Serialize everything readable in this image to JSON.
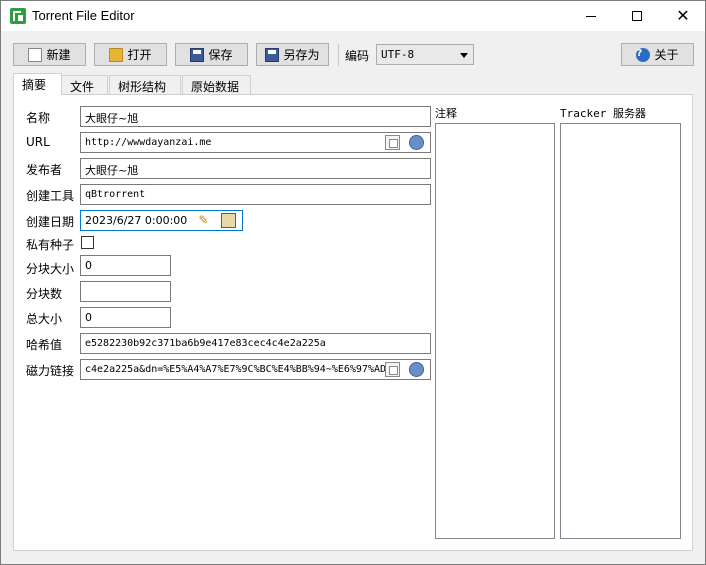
{
  "window": {
    "title": "Torrent File Editor"
  },
  "toolbar": {
    "new_label": "新建",
    "open_label": "打开",
    "save_label": "保存",
    "save_as_label": "另存为",
    "encoding_label": "编码",
    "encoding_value": "UTF-8",
    "about_label": "关于"
  },
  "tabs": [
    {
      "label": "摘要",
      "active": true
    },
    {
      "label": "文件",
      "active": false
    },
    {
      "label": "树形结构",
      "active": false
    },
    {
      "label": "原始数据",
      "active": false
    }
  ],
  "summary": {
    "name_label": "名称",
    "name_value": "大眼仔~旭",
    "url_label": "URL",
    "url_value": "http://wwwdayanzai.me",
    "publisher_label": "发布者",
    "publisher_value": "大眼仔~旭",
    "created_by_label": "创建工具",
    "created_by_value": "qBtrorrent",
    "created_date_label": "创建日期",
    "created_date_value": "2023/6/27 0:00:00",
    "private_label": "私有种子",
    "private_checked": false,
    "piece_size_label": "分块大小",
    "piece_size_value": "0",
    "pieces_label": "分块数",
    "pieces_value": "",
    "total_size_label": "总大小",
    "total_size_value": "0",
    "hash_label": "哈希值",
    "hash_value": "e5282230b92c371ba6b9e417e83cec4c4e2a225a",
    "magnet_label": "磁力链接",
    "magnet_value": "c4e2a225a&dn=%E5%A4%A7%E7%9C%BC%E4%BB%94~%E6%97%AD"
  },
  "side": {
    "comment_label": "注释",
    "trackers_label": "Tracker 服务器"
  }
}
